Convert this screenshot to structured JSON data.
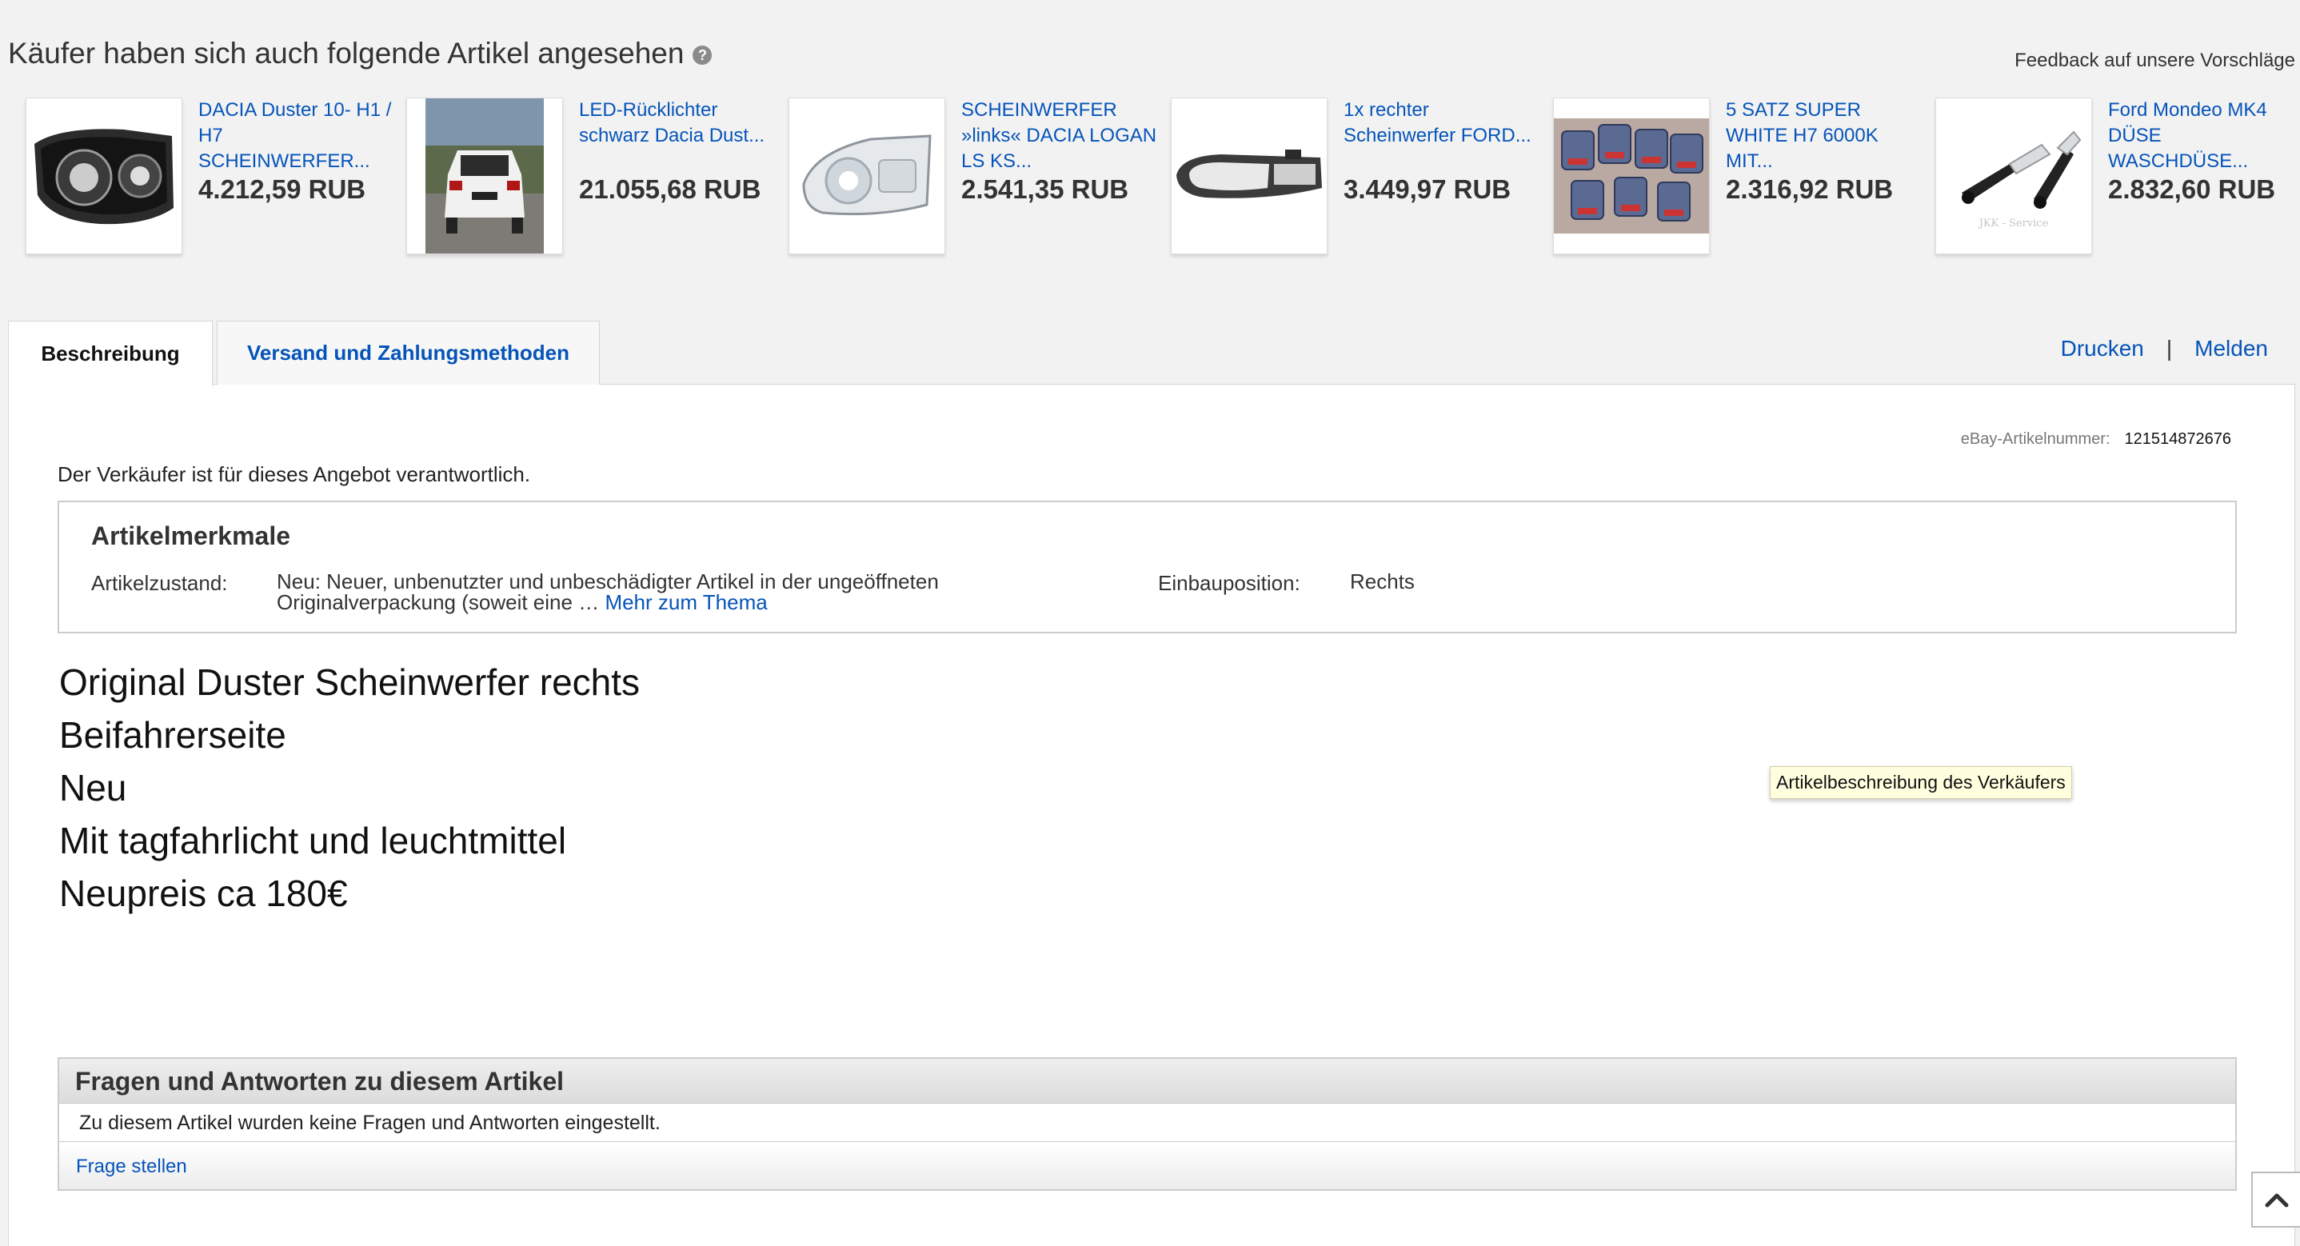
{
  "recommendations": {
    "title": "Käufer haben sich auch folgende Artikel angesehen",
    "help_icon": "?",
    "feedback_link": "Feedback auf unsere Vorschläge",
    "items": [
      {
        "title": "DACIA Duster 10- H1 / H7 SCHEINWERFER...",
        "price": "4.212,59 RUB",
        "image": "headlight-dark-icon"
      },
      {
        "title": "LED-Rücklichter schwarz Dacia Dust...",
        "price": "21.055,68 RUB",
        "image": "white-suv-rear-photo"
      },
      {
        "title": "SCHEINWERFER »links« DACIA LOGAN LS KS...",
        "price": "2.541,35 RUB",
        "image": "headlight-clear-icon"
      },
      {
        "title": "1x rechter Scheinwerfer FORD...",
        "price": "3.449,97 RUB",
        "image": "headlight-long-icon"
      },
      {
        "title": "5 SATZ SUPER WHITE H7 6000K MIT...",
        "price": "2.316,92 RUB",
        "image": "bulb-packs-photo"
      },
      {
        "title": "Ford Mondeo MK4 DÜSE WASCHDÜSE...",
        "price": "2.832,60 RUB",
        "image": "washer-nozzle-photo",
        "watermark": "JKK - Service"
      }
    ]
  },
  "tabs": {
    "description": "Beschreibung",
    "shipping": "Versand und Zahlungsmethoden"
  },
  "top_links": {
    "print": "Drucken",
    "separator": "|",
    "report": "Melden"
  },
  "item_number": {
    "label": "eBay-Artikelnummer:",
    "value": "121514872676"
  },
  "seller_note": "Der Verkäufer ist für dieses Angebot verantwortlich.",
  "specs": {
    "title": "Artikelmerkmale",
    "condition_label": "Artikelzustand:",
    "condition_value_line1": "Neu: Neuer, unbenutzter und unbeschädigter Artikel in der ungeöffneten",
    "condition_value_line2": "Originalverpackung (soweit eine …",
    "more_link": "Mehr zum Thema",
    "position_label": "Einbauposition:",
    "position_value": "Rechts"
  },
  "description_lines": [
    "Original Duster Scheinwerfer rechts",
    "Beifahrerseite",
    "Neu",
    "Mit tagfahrlicht und leuchtmittel",
    "Neupreis ca 180€"
  ],
  "tooltip": "Artikelbeschreibung des Verkäufers",
  "qa": {
    "title": "Fragen und Antworten zu diesem Artikel",
    "empty_text": "Zu diesem Artikel wurden keine Fragen und Antworten eingestellt.",
    "ask_link": "Frage stellen"
  },
  "scroll_top_icon": "chevron-up-icon"
}
